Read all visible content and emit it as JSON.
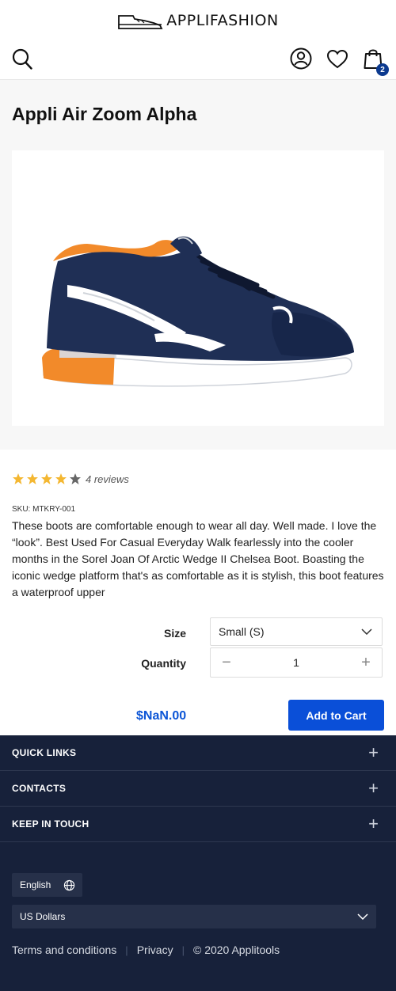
{
  "brand": {
    "name": "APPLIFASHION"
  },
  "header": {
    "cart_count": "2"
  },
  "product": {
    "title": "Appli Air Zoom Alpha",
    "rating": 4,
    "rating_max": 5,
    "reviews": "4 reviews",
    "sku": "SKU: MTKRY-001",
    "description": "These boots are comfortable enough to wear all day. Well made. I love the “look”. Best Used For Casual Everyday Walk fearlessly into the cooler months in the Sorel Joan Of Arctic Wedge II Chelsea Boot. Boasting the iconic wedge platform that's as comfortable as it is stylish, this boot features a waterproof upper",
    "size_label": "Size",
    "size_value": "Small (S)",
    "quantity_label": "Quantity",
    "quantity_value": "1",
    "quantity_minus": "−",
    "quantity_plus": "+",
    "price": "$NaN.00",
    "add_to_cart": "Add to Cart"
  },
  "footer": {
    "sections": [
      "QUICK LINKS",
      "CONTACTS",
      "KEEP IN TOUCH"
    ],
    "language": "English",
    "currency": "US Dollars",
    "links": [
      "Terms and conditions",
      "Privacy",
      "© 2020 Applitools"
    ]
  },
  "colors": {
    "accent": "#0a4fd8",
    "price": "#0c55d6",
    "footer_bg": "#17213a",
    "star": "#f4b731",
    "star_empty": "#666666"
  }
}
